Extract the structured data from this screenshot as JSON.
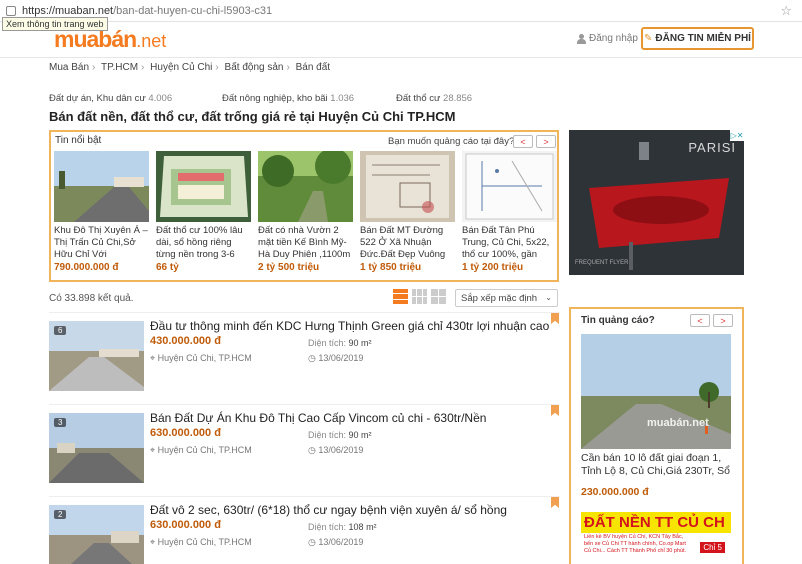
{
  "browser": {
    "url_host": "https://muaban.net",
    "url_path": "/ban-dat-huyen-cu-chi-l5903-c31",
    "tooltip": "Xem thông tin trang web"
  },
  "header": {
    "logo_main": "muabán",
    "logo_suffix": ".net",
    "login_label": "Đăng nhập",
    "post_button": "ĐĂNG TIN MIỄN PHÍ"
  },
  "breadcrumb": [
    "Mua Bán",
    "TP.HCM",
    "Huyện Củ Chi",
    "Bất động sản",
    "Bán đất"
  ],
  "categories": [
    {
      "label": "Đất dự án, Khu dân cư",
      "count": "4.006"
    },
    {
      "label": "Đất nông nghiệp, kho bãi",
      "count": "1.036"
    },
    {
      "label": "Đất thổ cư",
      "count": "28.856"
    }
  ],
  "page_title": "Bán đất nền, đất thổ cư, đất trống giá rẻ tại Huyện Củ Chi TP.HCM",
  "featured": {
    "title": "Tin nổi bật",
    "ad_prompt": "Bạn muốn quảng cáo tại đây?",
    "prev": "<",
    "next": ">",
    "items": [
      {
        "text": "Khu Đô Thị Xuyên Á – Thị Trấn Củ Chi,Sở Hữu Chỉ Với",
        "price": "790.000.000 đ"
      },
      {
        "text": "Đất thổ cư 100% lâu dài, sổ hồng riêng từng nền trong 3-6 tháng,",
        "price": "66 tỷ"
      },
      {
        "text": "Đất có nhà Vườn 2 mặt tiền Kế Bình Mỹ-Hà Duy Phiên ,1100m",
        "price": "2 tỷ 500 triệu"
      },
      {
        "text": "Bán Đất MT Đường 522 Ở Xã Nhuận Đức.Đất Đẹp Vuông",
        "price": "1 tỷ 850 triệu"
      },
      {
        "text": "Bán Đất Tân Phú Trung, Củ Chi, 5x22, thổ cư 100%, gần",
        "price": "1 tỷ 200 triệu"
      }
    ]
  },
  "banner": {
    "brand": "PARISI",
    "tag": "FREQUENT FLYER"
  },
  "results": {
    "count_text": "Có 33.898 kết quả.",
    "sort_label": "Sắp xếp mặc định"
  },
  "listings": [
    {
      "badge": "6",
      "title": "Đầu tư thông minh đến KDC Hưng Thịnh Green giá chỉ 430tr lợi nhuận cao",
      "price": "430.000.000 đ",
      "area_label": "Diện tích:",
      "area": "90 m²",
      "location": "Huyện Củ Chi, TP.HCM",
      "date": "13/06/2019"
    },
    {
      "badge": "3",
      "title": "Bán Đất Dự Án Khu Đô Thị Cao Cấp Vincom củ chi - 630tr/Nền",
      "price": "630.000.000 đ",
      "area_label": "Diện tích:",
      "area": "90 m²",
      "location": "Huyện Củ Chi, TP.HCM",
      "date": "13/06/2019"
    },
    {
      "badge": "2",
      "title": "Đất vô 2 sec, 630tr/ (6*18) thổ cư ngay bệnh viện xuyên á/ sổ hồng",
      "price": "630.000.000 đ",
      "area_label": "Diện tích:",
      "area": "108 m²",
      "location": "Huyện Củ Chi, TP.HCM",
      "date": "13/06/2019"
    }
  ],
  "side_ad": {
    "title": "Tin quảng cáo?",
    "watermark": "muabán.net",
    "text": "Cần bán 10 lô đất giai đoạn 1, Tỉnh Lộ 8, Củ Chi,Giá 230Tr, Sổ",
    "price": "230.000.000 đ",
    "sign_big": "ĐẤT NỀN TT CỦ CH",
    "sign_small": "Liền kề BV huyện Củ Chi, KCN Tây Bắc, bến xe Củ Chi TT hành chính, Co.op Mart Củ Chi... Cách TT Thành Phố chỉ 30 phút.",
    "sign_chip": "Chỉ 5"
  },
  "colors": {
    "accent": "#f47b20",
    "price": "#c05b0a",
    "border": "#f0b45a"
  }
}
